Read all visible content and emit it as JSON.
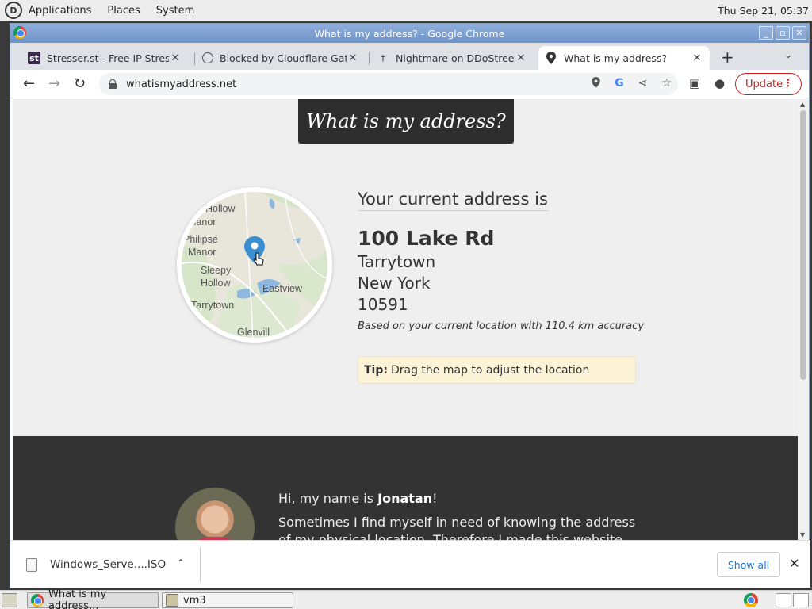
{
  "top_panel": {
    "menus": [
      "Applications",
      "Places",
      "System"
    ],
    "clock": "Thu Sep 21, 05:37"
  },
  "window": {
    "title": "What is my address? - Google Chrome",
    "controls": [
      "minimize",
      "maximize",
      "close"
    ]
  },
  "tabs": [
    {
      "label": "Stresser.st - Free IP Stresser",
      "icon": "stresser-favicon",
      "favicon_text": "st"
    },
    {
      "label": "Blocked by Cloudflare Gateway",
      "icon": "globe-icon"
    },
    {
      "label": "Nightmare on DDoStreet |",
      "icon": "dagger-favicon",
      "favicon_text": "†"
    },
    {
      "label": "What is my address?",
      "icon": "location-pin-icon",
      "active": true
    }
  ],
  "toolbar": {
    "url": "whatismyaddress.net",
    "update_label": "Update"
  },
  "page": {
    "banner_title": "What is my address?",
    "address_heading": "Your current address is",
    "street": "100 Lake Rd",
    "city": "Tarrytown",
    "state": "New York",
    "zip": "10591",
    "accuracy_text": "Based on your current location with 110.4 km accuracy",
    "tip_label": "Tip:",
    "tip_text": "Drag the map to adjust the location",
    "map_labels": [
      "Hollow",
      "Manor",
      "Philipse",
      "Manor",
      "Sleepy",
      "Hollow",
      "Eastview",
      "Tarrytown",
      "Glenvill"
    ],
    "author_greeting_prefix": "Hi, my name is ",
    "author_name": "Jonatan",
    "author_greeting_suffix": "!",
    "author_text": "Sometimes I find myself in need of knowing the address of my physical location. Therefore I made this website for"
  },
  "downloads": {
    "file_name": "Windows_Serve....ISO",
    "show_all_label": "Show all"
  },
  "taskbar": {
    "tasks": [
      "What is my address...",
      "vm3"
    ]
  },
  "colors": {
    "banner_bg": "#2d2d2d",
    "tip_bg": "#fdf4d7",
    "update_red": "#c5221f",
    "pin_blue": "#3b8fd1"
  }
}
